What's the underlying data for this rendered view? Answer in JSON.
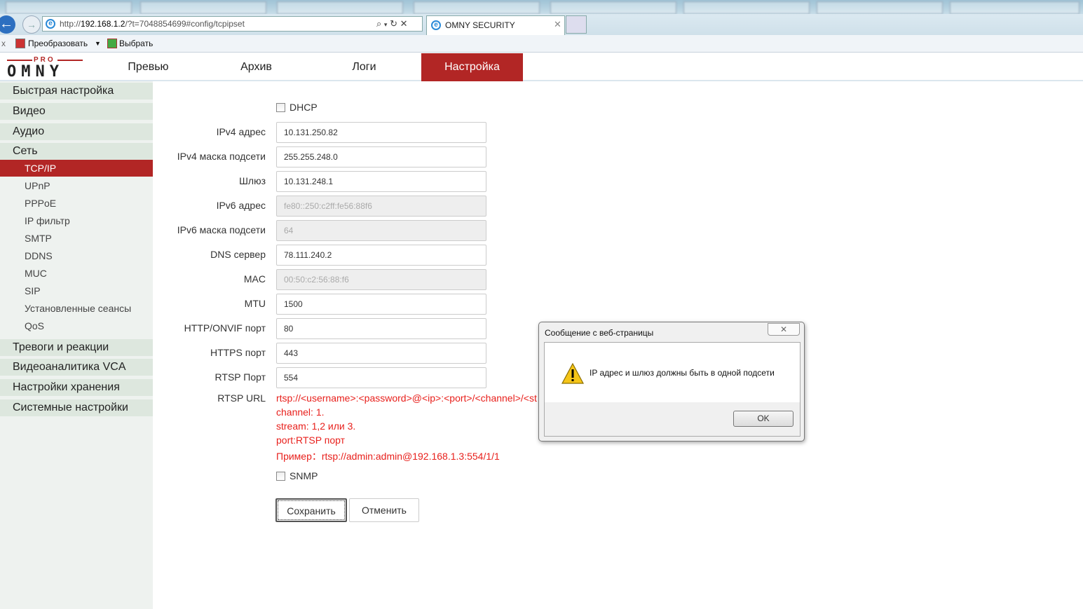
{
  "browser": {
    "url_host": "192.168.1.2",
    "url_prefix": "http://",
    "url_rest": "/?t=7048854699#config/tcpipset",
    "tab_title": "OMNY SECURITY",
    "cmd_convert": "Преобразовать",
    "cmd_select": "Выбрать",
    "close_x": "x"
  },
  "logo": {
    "top": "PRO",
    "main": "OMNY"
  },
  "nav": [
    {
      "label": "Превью"
    },
    {
      "label": "Архив"
    },
    {
      "label": "Логи"
    },
    {
      "label": "Настройка"
    }
  ],
  "sidebar": {
    "groups": [
      "Быстрая настройка",
      "Видео",
      "Аудио",
      "Сеть",
      "Тревоги и реакции",
      "Видеоаналитика VCA",
      "Настройки хранения",
      "Системные настройки"
    ],
    "network_items": [
      "TCP/IP",
      "UPnP",
      "PPPoE",
      "IP фильтр",
      "SMTP",
      "DDNS",
      "MUC",
      "SIP",
      "Установленные сеансы",
      "QoS"
    ]
  },
  "form": {
    "dhcp_label": "DHCP",
    "dhcp_checked": false,
    "fields": [
      {
        "label": "IPv4 адрес",
        "value": "10.131.250.82"
      },
      {
        "label": "IPv4 маска подсети",
        "value": "255.255.248.0"
      },
      {
        "label": "Шлюз",
        "value": "10.131.248.1"
      },
      {
        "label": "IPv6 адрес",
        "value": "fe80::250:c2ff:fe56:88f6"
      },
      {
        "label": "IPv6 маска подсети",
        "value": "64"
      },
      {
        "label": "DNS сервер",
        "value": "78.111.240.2"
      },
      {
        "label": "MAC",
        "value": "00:50:c2:56:88:f6"
      },
      {
        "label": "MTU",
        "value": "1500"
      },
      {
        "label": "HTTP/ONVIF порт",
        "value": "80"
      },
      {
        "label": "HTTPS порт",
        "value": "443"
      },
      {
        "label": "RTSP Порт",
        "value": "554"
      }
    ],
    "rtsp_label": "RTSP URL",
    "rtsp_help": [
      "rtsp://<username>:<password>@<ip>:<port>/<channel>/<st",
      "channel: 1.",
      "stream: 1,2 или 3.",
      "port:RTSP порт",
      "Пример：rtsp://admin:admin@192.168.1.3:554/1/1"
    ],
    "snmp_label": "SNMP",
    "snmp_checked": false,
    "save": "Сохранить",
    "cancel": "Отменить"
  },
  "dialog": {
    "title": "Сообщение с веб-страницы",
    "message": "IP адрес и шлюз должны быть в одной подсети",
    "ok": "OK",
    "close": "✕"
  },
  "colors": {
    "accent": "#b22625",
    "help_text": "#e8201c"
  }
}
